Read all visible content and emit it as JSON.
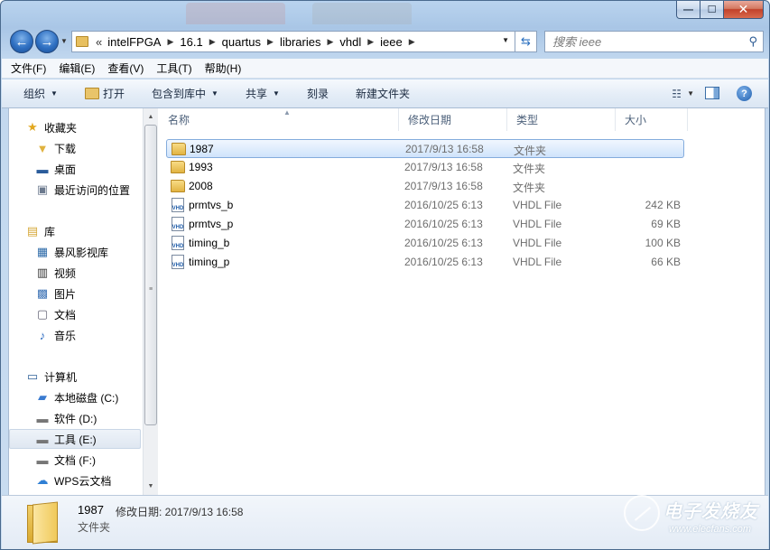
{
  "window": {
    "caption": {
      "min": "—",
      "max": "☐",
      "close": "✕"
    }
  },
  "nav": {
    "back": "←",
    "forward": "→",
    "address": {
      "overflow": "«",
      "crumbs": [
        "intelFPGA",
        "16.1",
        "quartus",
        "libraries",
        "vhdl",
        "ieee"
      ]
    },
    "refresh": "⇆",
    "search": {
      "placeholder": "搜索 ieee",
      "icon": "search-icon"
    }
  },
  "menubar": {
    "items": [
      "文件(F)",
      "编辑(E)",
      "查看(V)",
      "工具(T)",
      "帮助(H)"
    ]
  },
  "toolbar": {
    "organize": "组织",
    "open": "打开",
    "include_in_library": "包含到库中",
    "share": "共享",
    "burn": "刻录",
    "new_folder": "新建文件夹"
  },
  "sidebar": {
    "groups": [
      {
        "label": "收藏夹",
        "icon": "star-icon",
        "items": [
          {
            "label": "下载",
            "icon": "download-folder-icon"
          },
          {
            "label": "桌面",
            "icon": "desktop-icon"
          },
          {
            "label": "最近访问的位置",
            "icon": "recent-places-icon"
          }
        ]
      },
      {
        "label": "库",
        "icon": "library-icon",
        "items": [
          {
            "label": "暴风影视库",
            "icon": "video-library-icon"
          },
          {
            "label": "视频",
            "icon": "film-icon"
          },
          {
            "label": "图片",
            "icon": "picture-icon"
          },
          {
            "label": "文档",
            "icon": "document-icon"
          },
          {
            "label": "音乐",
            "icon": "music-icon"
          }
        ]
      },
      {
        "label": "计算机",
        "icon": "computer-icon",
        "items": [
          {
            "label": "本地磁盘 (C:)",
            "icon": "system-drive-icon"
          },
          {
            "label": "软件 (D:)",
            "icon": "drive-icon"
          },
          {
            "label": "工具 (E:)",
            "icon": "drive-icon",
            "selected": true
          },
          {
            "label": "文档 (F:)",
            "icon": "drive-icon"
          },
          {
            "label": "WPS云文档",
            "icon": "cloud-icon"
          }
        ]
      }
    ]
  },
  "filelist": {
    "columns": [
      "名称",
      "修改日期",
      "类型",
      "大小"
    ],
    "rows": [
      {
        "name": "1987",
        "date": "2017/9/13 16:58",
        "type": "文件夹",
        "size": "",
        "icon": "folder-icon",
        "selected": true
      },
      {
        "name": "1993",
        "date": "2017/9/13 16:58",
        "type": "文件夹",
        "size": "",
        "icon": "folder-icon"
      },
      {
        "name": "2008",
        "date": "2017/9/13 16:58",
        "type": "文件夹",
        "size": "",
        "icon": "folder-icon"
      },
      {
        "name": "prmtvs_b",
        "date": "2016/10/25 6:13",
        "type": "VHDL File",
        "size": "242 KB",
        "icon": "vhdl-file-icon"
      },
      {
        "name": "prmtvs_p",
        "date": "2016/10/25 6:13",
        "type": "VHDL File",
        "size": "69 KB",
        "icon": "vhdl-file-icon"
      },
      {
        "name": "timing_b",
        "date": "2016/10/25 6:13",
        "type": "VHDL File",
        "size": "100 KB",
        "icon": "vhdl-file-icon"
      },
      {
        "name": "timing_p",
        "date": "2016/10/25 6:13",
        "type": "VHDL File",
        "size": "66 KB",
        "icon": "vhdl-file-icon"
      }
    ]
  },
  "details": {
    "name": "1987",
    "meta": "修改日期: 2017/9/13 16:58",
    "type": "文件夹"
  },
  "watermark": {
    "text": "电子发烧友",
    "url": "www.elecfans.com"
  }
}
